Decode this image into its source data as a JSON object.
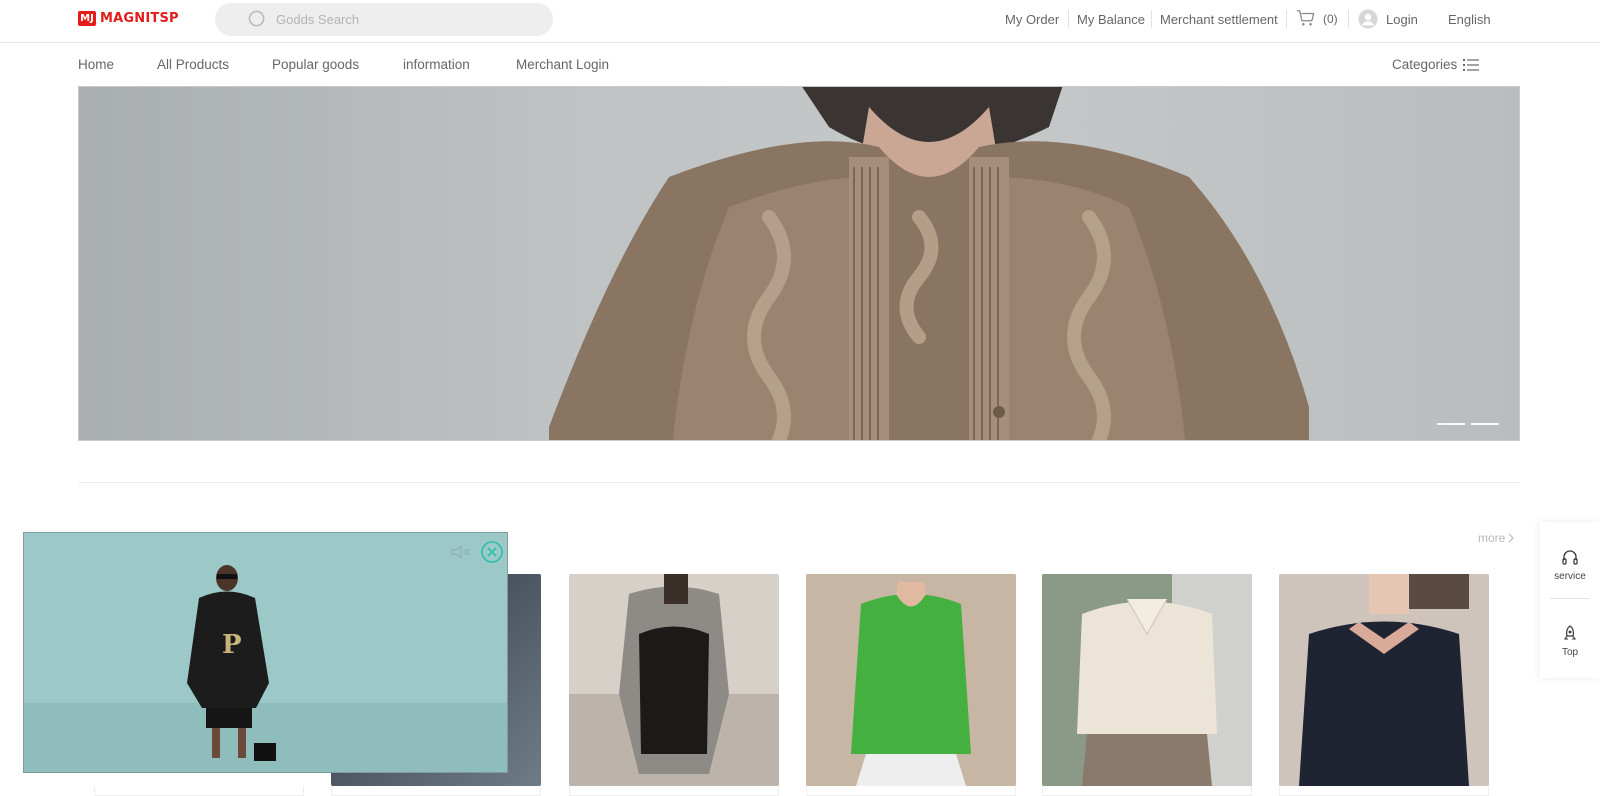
{
  "header": {
    "logo_text": "MAGNITSP",
    "search_placeholder": "Godds Search",
    "links": {
      "my_order": "My Order",
      "my_balance": "My Balance",
      "merchant_settlement": "Merchant settlement",
      "cart_count": "(0)",
      "login": "Login",
      "language": "English"
    }
  },
  "nav": {
    "items": [
      "Home",
      "All Products",
      "Popular goods",
      "information",
      "Merchant Login"
    ],
    "categories": "Categories"
  },
  "banner": {
    "slides": 2,
    "active_slide": 1
  },
  "section": {
    "more": "more"
  },
  "sidebar": {
    "service": "service",
    "top": "Top"
  },
  "colors": {
    "brand": "#e31d1a",
    "close_accent": "#2bbfae"
  }
}
